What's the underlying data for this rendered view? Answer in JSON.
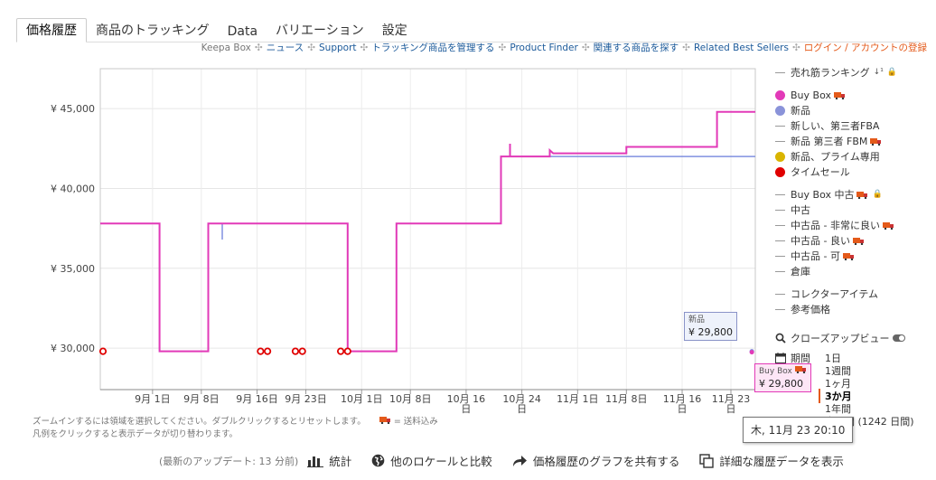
{
  "tabs": [
    {
      "label": "価格履歴",
      "active": true
    },
    {
      "label": "商品のトラッキング",
      "active": false
    },
    {
      "label": "Data",
      "active": false
    },
    {
      "label": "バリエーション",
      "active": false
    },
    {
      "label": "設定",
      "active": false
    }
  ],
  "links": {
    "keepa_box": "Keepa Box",
    "news": "ニュース",
    "support": "Support",
    "manage": "トラッキング商品を管理する",
    "finder": "Product Finder",
    "related_search": "関連する商品を探す",
    "related_best": "Related Best Sellers",
    "login": "ログイン / アカウントの登録"
  },
  "chart_data": {
    "type": "line",
    "y_ticks": [
      "¥ 45,000",
      "¥ 40,000",
      "¥ 35,000",
      "¥ 30,000"
    ],
    "y_values": [
      45000,
      40000,
      35000,
      30000
    ],
    "ylim": [
      27400,
      47500
    ],
    "x_ticks": [
      "9月 1日",
      "9月 8日",
      "9月 16日",
      "9月 23日",
      "10月 1日",
      "10月 8日",
      "10月 16日",
      "10月 24日",
      "11月 1日",
      "11月 8日",
      "11月 16日",
      "11月 23日"
    ],
    "x_tick_days": [
      1,
      8,
      16,
      23,
      31,
      38,
      46,
      54,
      62,
      69,
      77,
      84
    ],
    "xlim": [
      -6.5,
      87.5
    ],
    "grid": true,
    "series": [
      {
        "name": "Buy Box",
        "color": "#e23ab8",
        "points": [
          [
            -6.5,
            37800
          ],
          [
            2,
            37800
          ],
          [
            2,
            29800
          ],
          [
            9,
            29800
          ],
          [
            9,
            37800
          ],
          [
            29,
            37800
          ],
          [
            29,
            29800
          ],
          [
            36,
            29800
          ],
          [
            36,
            37800
          ],
          [
            51,
            37800
          ],
          [
            51,
            42000
          ],
          [
            52.3,
            42000
          ],
          [
            52.3,
            42800
          ],
          [
            52.3,
            42000
          ],
          [
            58,
            42000
          ],
          [
            58,
            42400
          ],
          [
            58.5,
            42200
          ],
          [
            69,
            42200
          ],
          [
            69,
            42600
          ],
          [
            82,
            42600
          ],
          [
            82,
            44800
          ],
          [
            88,
            44800
          ],
          [
            88,
            29800
          ],
          [
            92,
            29800
          ]
        ]
      },
      {
        "name": "新品",
        "color": "#8090e0",
        "points": [
          [
            -6.5,
            37800
          ],
          [
            2,
            37800
          ],
          [
            2,
            29800
          ],
          [
            9,
            29800
          ],
          [
            9,
            37800
          ],
          [
            11,
            37800
          ],
          [
            11,
            36800
          ],
          [
            11,
            37800
          ],
          [
            29,
            37800
          ],
          [
            29,
            29800
          ],
          [
            36,
            29800
          ],
          [
            36,
            37800
          ],
          [
            51,
            37800
          ],
          [
            51,
            42000
          ],
          [
            88,
            42000
          ],
          [
            88,
            29800
          ],
          [
            92,
            29800
          ]
        ]
      },
      {
        "name": "タイムセール",
        "color": "#e00000",
        "markers": [
          [
            -6.5,
            29800
          ],
          [
            16.5,
            29800
          ],
          [
            17.5,
            29800
          ],
          [
            21.5,
            29800
          ],
          [
            22.5,
            29800
          ],
          [
            28,
            29800
          ],
          [
            29,
            29800
          ]
        ]
      }
    ]
  },
  "legend": {
    "sales_rank": "売れ筋ランキング",
    "buy_box": "Buy Box",
    "new": "新品",
    "new_3p_fba": "新しい、第三者FBA",
    "new_3p_fbm": "新品 第三者 FBM",
    "new_prime": "新品、プライム専用",
    "lightning": "タイムセール",
    "buybox_used": "Buy Box 中古",
    "used": "中古",
    "used_like_new": "中古品 - 非常に良い",
    "used_good": "中古品 - 良い",
    "used_acceptable": "中古品 - 可",
    "warehouse": "倉庫",
    "collectible": "コレクターアイテム",
    "list_price": "参考価格",
    "colors": {
      "buy_box": "#e23ab8",
      "new": "#8a93d9",
      "new_prime": "#d9b400",
      "lightning": "#e00000"
    }
  },
  "close_up": "クローズアップビュー",
  "range": {
    "label": "期間",
    "options": [
      "1日",
      "1週間",
      "1ヶ月",
      "3か月",
      "1年間",
      "全期間 (1242 日間)"
    ],
    "selected_index": 3
  },
  "footnote": {
    "line1": "ズームインするには領域を選択してください。ダブルクリックするとリセットします。",
    "truck_note": "= 送料込み",
    "line2": "凡例をクリックすると表示データが切り替わります。"
  },
  "bottom": {
    "updated": "(最新のアップデート: 13 分前)",
    "stats": "統計",
    "compare": "他のロケールと比較",
    "share": "価格履歴のグラフを共有する",
    "detail": "詳細な履歴データを表示"
  },
  "tooltips": {
    "new_label": "新品",
    "new_value": "¥ 29,800",
    "bb_label": "Buy Box",
    "bb_value": "¥ 29,800",
    "date": "木, 11月 23 20:10"
  }
}
